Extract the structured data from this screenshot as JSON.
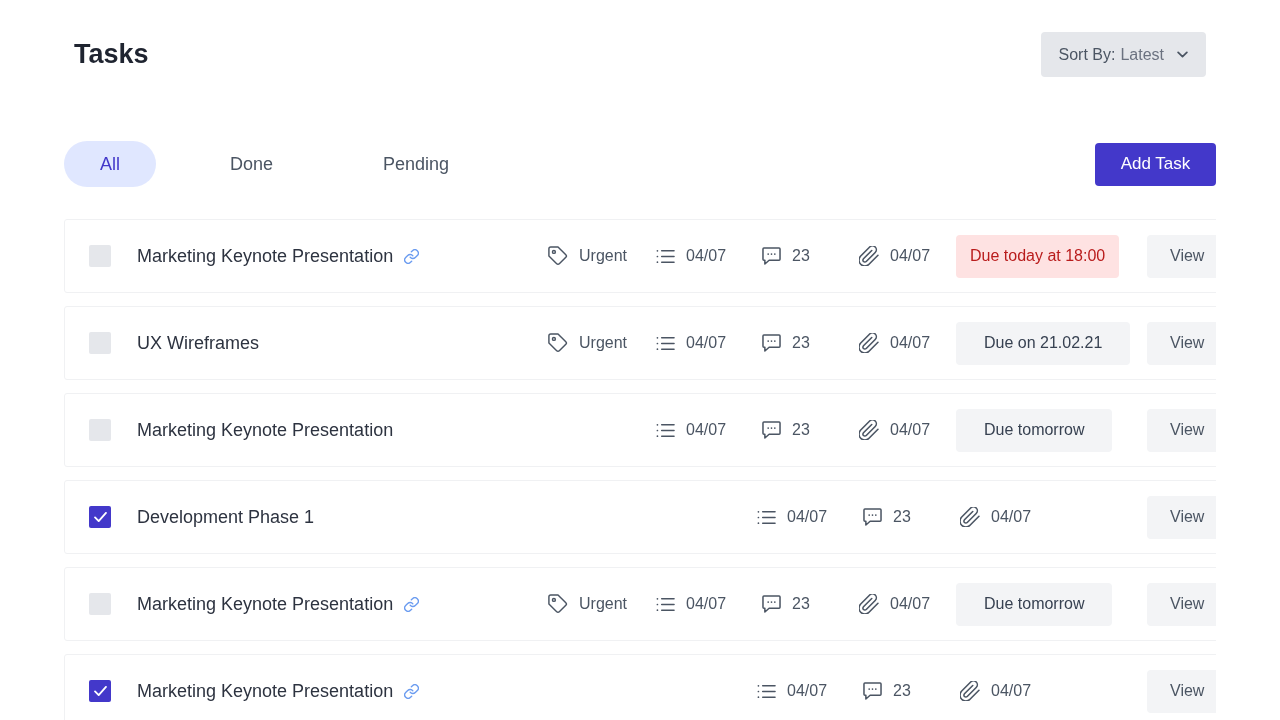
{
  "header": {
    "title": "Tasks",
    "sort": {
      "label": "Sort By:",
      "value": "Latest"
    }
  },
  "tabs": [
    {
      "label": "All",
      "selected": true
    },
    {
      "label": "Done",
      "selected": false
    },
    {
      "label": "Pending",
      "selected": false
    }
  ],
  "add_button": "Add Task",
  "tasks": [
    {
      "title": "Marketing Keynote Presentation",
      "checked": false,
      "linked": true,
      "tag": "Urgent",
      "checklist": "04/07",
      "comments": "23",
      "attachments": "04/07",
      "due": {
        "text": "Due today at 18:00",
        "kind": "today"
      },
      "action": "View"
    },
    {
      "title": "UX Wireframes",
      "checked": false,
      "linked": false,
      "tag": "Urgent",
      "checklist": "04/07",
      "comments": "23",
      "attachments": "04/07",
      "due": {
        "text": "Due on 21.02.21",
        "kind": "upcoming"
      },
      "action": "View"
    },
    {
      "title": "Marketing Keynote Presentation",
      "checked": false,
      "linked": false,
      "checklist": "04/07",
      "comments": "23",
      "attachments": "04/07",
      "due": {
        "text": "Due tomorrow",
        "kind": "upcoming"
      },
      "action": "View"
    },
    {
      "title": "Development Phase 1",
      "checked": true,
      "linked": false,
      "checklist": "04/07",
      "comments": "23",
      "attachments": "04/07",
      "action": "View"
    },
    {
      "title": "Marketing Keynote Presentation",
      "checked": false,
      "linked": true,
      "tag": "Urgent",
      "checklist": "04/07",
      "comments": "23",
      "attachments": "04/07",
      "due": {
        "text": "Due tomorrow",
        "kind": "upcoming"
      },
      "action": "View"
    },
    {
      "title": "Marketing Keynote Presentation",
      "checked": true,
      "linked": true,
      "checklist": "04/07",
      "comments": "23",
      "attachments": "04/07",
      "action": "View"
    }
  ]
}
